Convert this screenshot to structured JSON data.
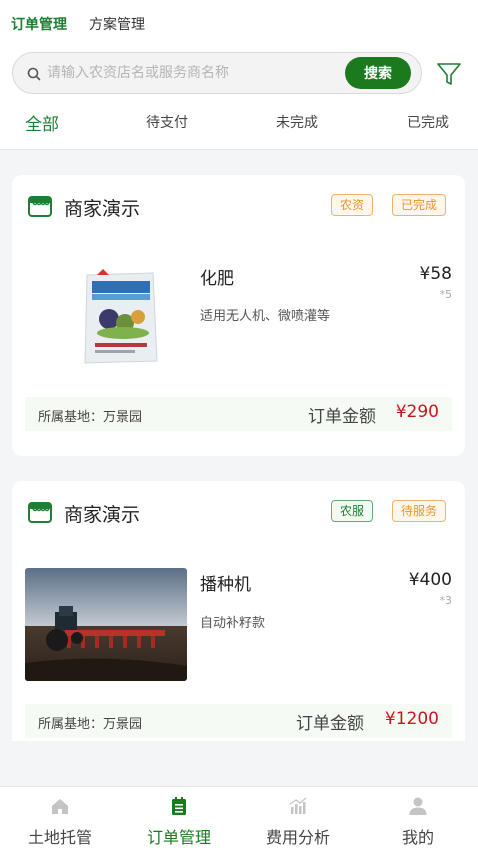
{
  "top_tabs": [
    {
      "label": "订单管理",
      "active": true
    },
    {
      "label": "方案管理",
      "active": false
    }
  ],
  "search": {
    "placeholder": "请输入农资店名或服务商名称",
    "value": "",
    "button_label": "搜索"
  },
  "status_tabs": [
    {
      "label": "全部",
      "active": true
    },
    {
      "label": "待支付",
      "active": false
    },
    {
      "label": "未完成",
      "active": false
    },
    {
      "label": "已完成",
      "active": false
    }
  ],
  "orders": [
    {
      "shop_name": "商家演示",
      "tags": [
        {
          "label": "农资",
          "color": "orange"
        },
        {
          "label": "已完成",
          "color": "orange"
        }
      ],
      "product": {
        "name": "化肥",
        "desc": "适用无人机、微喷灌等",
        "price": "¥58",
        "qty": "*5",
        "image": "fertilizer-bag"
      },
      "base_label": "所属基地：万景园",
      "total_label": "订单金额",
      "total_value": "¥290"
    },
    {
      "shop_name": "商家演示",
      "tags": [
        {
          "label": "农服",
          "color": "green"
        },
        {
          "label": "待服务",
          "color": "orange"
        }
      ],
      "product": {
        "name": "播种机",
        "desc": "自动补籽款",
        "price": "¥400",
        "qty": "*3",
        "image": "tractor-seeder"
      },
      "base_label": "所属基地：万景园",
      "total_label": "订单金额",
      "total_value": "¥1200"
    }
  ],
  "bottom_nav": [
    {
      "label": "土地托管",
      "icon": "home-icon",
      "active": false
    },
    {
      "label": "订单管理",
      "icon": "clipboard-icon",
      "active": true
    },
    {
      "label": "费用分析",
      "icon": "bar-chart-icon",
      "active": false
    },
    {
      "label": "我的",
      "icon": "user-icon",
      "active": false
    }
  ],
  "colors": {
    "brand_green": "#1c7a1e",
    "price_red": "#c8161d",
    "tag_orange": "#e8962d"
  }
}
